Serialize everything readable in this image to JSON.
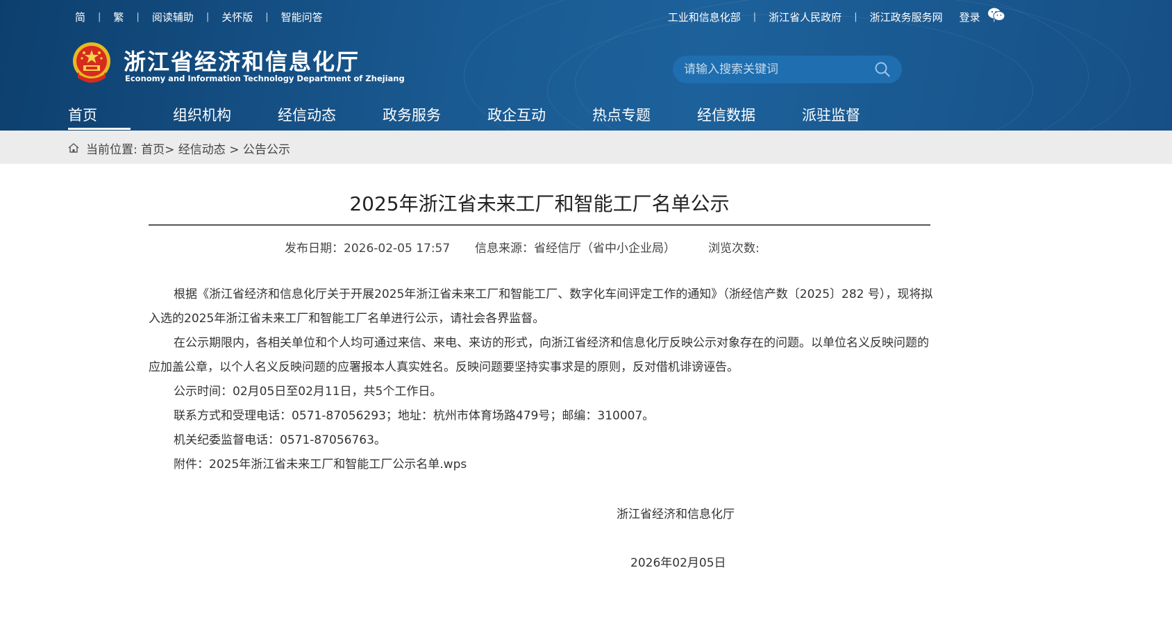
{
  "topbar": {
    "left_links": [
      "简",
      "繁",
      "阅读辅助",
      "关怀版",
      "智能问答"
    ],
    "right_links": [
      "工业和信息化部",
      "浙江省人民政府",
      "浙江政务服务网",
      "登录"
    ]
  },
  "header": {
    "title": "浙江省经济和信息化厅",
    "subtitle": "Economy and Information Technology Department of Zhejiang",
    "search_placeholder": "请输入搜索关键词"
  },
  "nav": {
    "items": [
      "首页",
      "组织机构",
      "经信动态",
      "政务服务",
      "政企互动",
      "热点专题",
      "经信数据",
      "派驻监督"
    ],
    "active_index": 0
  },
  "breadcrumb": {
    "label": "当前位置:",
    "path": "首页> 经信动态 > 公告公示"
  },
  "article": {
    "title": "2025年浙江省未来工厂和智能工厂名单公示",
    "publish_date": "发布日期：2026-02-05 17:57",
    "source": "信息来源：省经信厅（省中小企业局）",
    "views": "浏览次数:",
    "paragraphs": [
      "根据《浙江省经济和信息化厅关于开展2025年浙江省未来工厂和智能工厂、数字化车间评定工作的通知》（浙经信产数〔2025〕282 号），现将拟入选的2025年浙江省未来工厂和智能工厂名单进行公示，请社会各界监督。",
      "在公示期限内，各相关单位和个人均可通过来信、来电、来访的形式，向浙江省经济和信息化厅反映公示对象存在的问题。以单位名义反映问题的应加盖公章，以个人名义反映问题的应署报本人真实姓名。反映问题要坚持实事求是的原则，反对借机诽谤诬告。",
      "公示时间：02月05日至02月11日，共5个工作日。",
      "联系方式和受理电话：0571-87056293；地址：杭州市体育场路479号；邮编：310007。",
      "机关纪委监督电话：0571-87056763。"
    ],
    "attachment": "附件：2025年浙江省未来工厂和智能工厂公示名单.wps",
    "signature": "浙江省经济和信息化厅",
    "sign_date": "2026年02月05日"
  },
  "colors": {
    "header_bg": "#1a5a92",
    "search_bg": "#1e6eb0",
    "breadcrumb_bg": "#ececec"
  },
  "icons": [
    "wechat-icon",
    "search-icon",
    "home-icon",
    "national-emblem-icon"
  ]
}
